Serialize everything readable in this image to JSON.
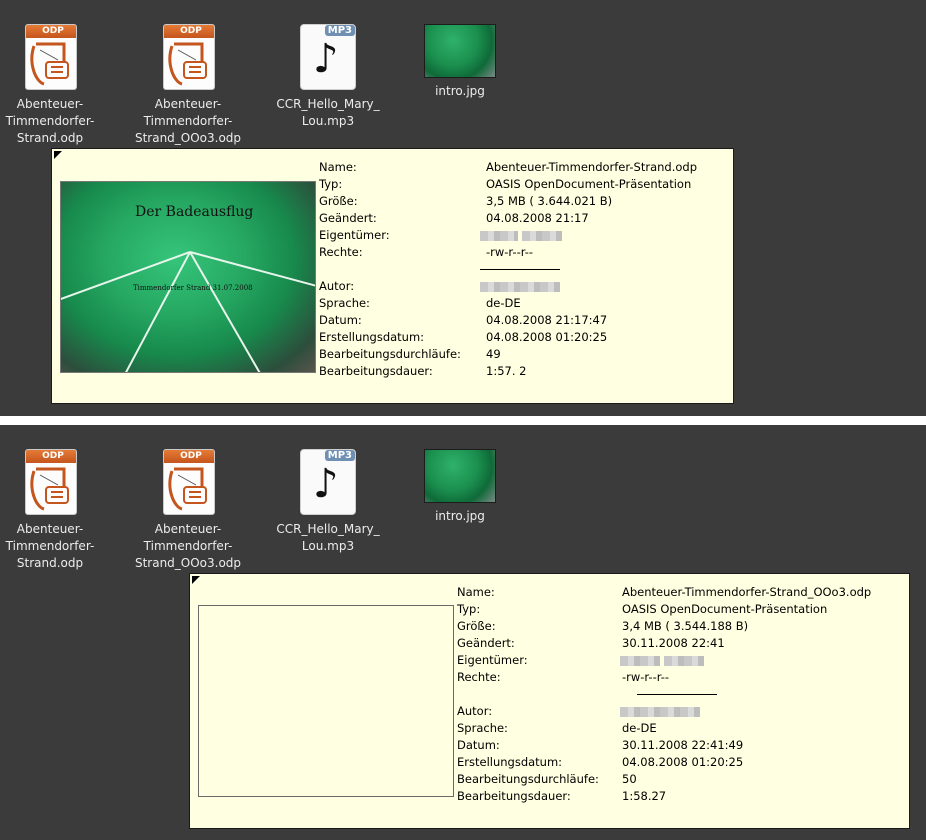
{
  "desktop_icons": [
    {
      "label": "Abenteuer-\nTimmendorfer-\nStrand.odp",
      "type": "odp",
      "icon": "odp-file-icon",
      "badge": "ODP"
    },
    {
      "label": "Abenteuer-\nTimmendorfer-\nStrand_OOo3.odp",
      "type": "odp",
      "icon": "odp-file-icon",
      "badge": "ODP"
    },
    {
      "label": "CCR_Hello_Mary_\nLou.mp3",
      "type": "mp3",
      "icon": "mp3-file-icon",
      "badge": "MP3"
    },
    {
      "label": "intro.jpg",
      "type": "jpg",
      "icon": "image-thumbnail-icon"
    }
  ],
  "colors": {
    "desktop_bg": "#3b3b3b",
    "tooltip_bg": "#ffffe1",
    "divider": "#ffffff"
  },
  "tooltip_top": {
    "preview": {
      "title": "Der Badeausflug",
      "subtitle": "Timmendorfer Strand 31.07.2008"
    },
    "labels": {
      "name": "Name:",
      "type": "Typ:",
      "size": "Größe:",
      "modified": "Geändert:",
      "owner": "Eigentümer:",
      "perms": "Rechte:",
      "author": "Autor:",
      "lang": "Sprache:",
      "date": "Datum:",
      "created": "Erstellungsdatum:",
      "revisions": "Bearbeitungsdurchläufe:",
      "duration": "Bearbeitungsdauer:"
    },
    "values": {
      "name": "Abenteuer-Timmendorfer-Strand.odp",
      "type": "OASIS OpenDocument-Präsentation",
      "size": "3,5 MB ( 3.644.021 B)",
      "modified": "04.08.2008 21:17",
      "perms": "-rw-r--r--",
      "lang": "de-DE",
      "date": "04.08.2008 21:17:47",
      "created": "04.08.2008 01:20:25",
      "revisions": "49",
      "duration": "1:57. 2"
    }
  },
  "tooltip_bottom": {
    "labels": {
      "name": "Name:",
      "type": "Typ:",
      "size": "Größe:",
      "modified": "Geändert:",
      "owner": "Eigentümer:",
      "perms": "Rechte:",
      "author": "Autor:",
      "lang": "Sprache:",
      "date": "Datum:",
      "created": "Erstellungsdatum:",
      "revisions": "Bearbeitungsdurchläufe:",
      "duration": "Bearbeitungsdauer:"
    },
    "values": {
      "name": "Abenteuer-Timmendorfer-Strand_OOo3.odp",
      "type": "OASIS OpenDocument-Präsentation",
      "size": "3,4 MB ( 3.544.188 B)",
      "modified": "30.11.2008 22:41",
      "perms": "-rw-r--r--",
      "lang": "de-DE",
      "date": "30.11.2008 22:41:49",
      "created": "04.08.2008 01:20:25",
      "revisions": "50",
      "duration": "1:58.27"
    }
  }
}
